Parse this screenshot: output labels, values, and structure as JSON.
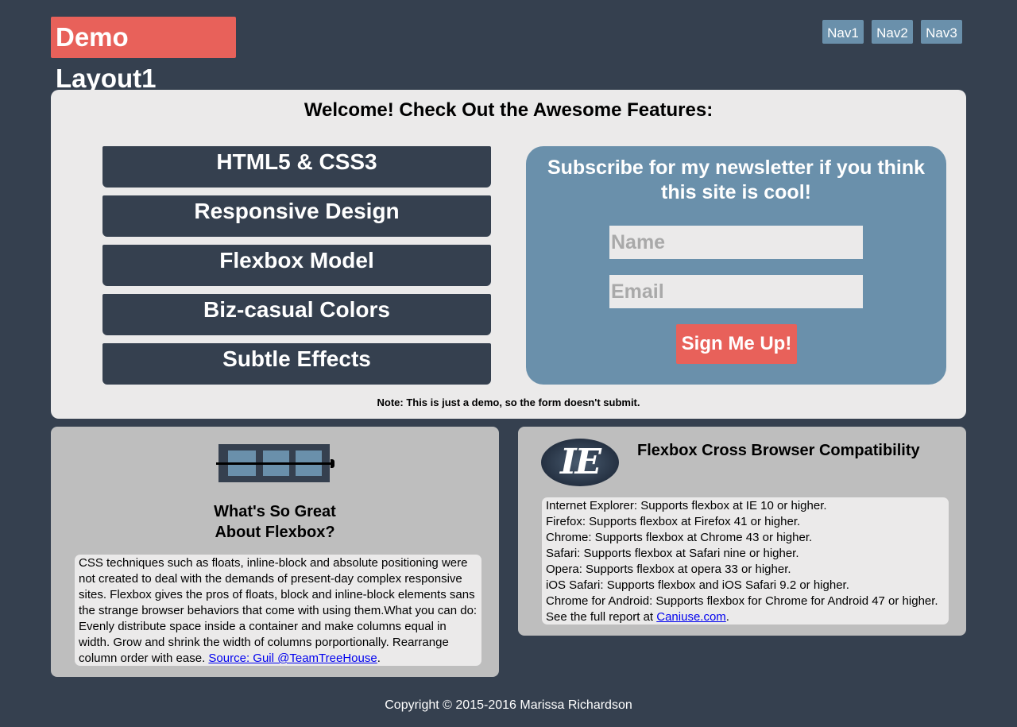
{
  "header": {
    "logo": "Demo Layout1",
    "nav": [
      "Nav1",
      "Nav2",
      "Nav3"
    ]
  },
  "welcome": {
    "title": "Welcome! Check Out the Awesome Features:",
    "features": [
      "HTML5 & CSS3",
      "Responsive Design",
      "Flexbox Model",
      "Biz-casual Colors",
      "Subtle Effects"
    ],
    "newsletter": {
      "title": "Subscribe for my newsletter if you think this site is cool!",
      "name_placeholder": "Name",
      "email_placeholder": "Email",
      "button": "Sign Me Up!"
    },
    "note": "Note: This is just a demo, so the form doesn't submit."
  },
  "flexbox_card": {
    "title_line1": "What's So Great",
    "title_line2": "About Flexbox?",
    "text": "CSS techniques such as floats, inline-block and absolute positioning were not created to deal with the demands of present-day complex responsive sites. Flexbox gives the pros of floats, block and inline-block elements sans the strange browser behaviors that come with using them.What you can do: Evenly distribute space inside a container and make columns equal in width. Grow and shrink the width of columns porportionally. Rearrange column order with ease.",
    "source_link": "Source: Guil @TeamTreeHouse",
    "source_suffix": "."
  },
  "compat_card": {
    "logo_text": "IE",
    "title": "Flexbox Cross Browser Compatibility",
    "lines": [
      "Internet Explorer: Supports flexbox at IE 10 or higher.",
      "Firefox: Supports flexbox at Firefox 41 or higher.",
      "Chrome: Supports flexbox at Chrome 43 or higher.",
      "Safari: Supports flexbox at Safari nine or higher.",
      "Opera: Supports flexbox at opera 33 or higher.",
      "iOS Safari: Supports flexbox and iOS Safari 9.2 or higher.",
      "Chrome for Android: Supports flexbox for Chrome for Android 47 or higher."
    ],
    "report_prefix": "See the full report at ",
    "report_link": "Caniuse.com",
    "report_suffix": "."
  },
  "footer": "Copyright © 2015-2016 Marissa Richardson",
  "colors": {
    "background": "#35404f",
    "accent": "#e8615a",
    "blue": "#6a90ab",
    "panel": "#ebeaea",
    "card": "#bebebe"
  }
}
